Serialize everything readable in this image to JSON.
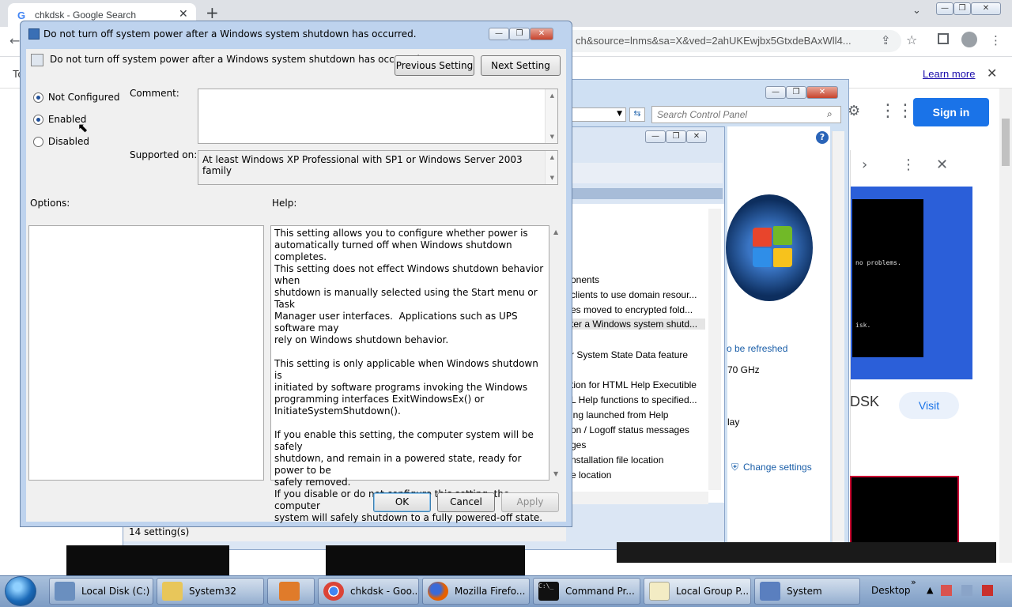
{
  "chrome": {
    "tab_title": "chkdsk - Google Search",
    "tab_favicon": "G",
    "new_tab": "+",
    "url_fragment": "ch&source=lnms&sa=X&ved=2ahUKEwjbx5GtxdeBAxWll4...",
    "infobar_left": "To",
    "learn_more": "Learn more",
    "sign_in": "Sign in",
    "card_title_fragment": "DSK",
    "visit": "Visit",
    "card_terminal_lines": [
      "no problems.",
      "",
      "",
      "",
      "isk."
    ]
  },
  "control_panel": {
    "search_placeholder": "Search Control Panel",
    "to_be_refreshed": "o be refreshed",
    "cpu_speed": "70 GHz",
    "display_fragment": "lay",
    "change_settings": "Change settings"
  },
  "group_policy": {
    "items": [
      "onents",
      "clients to use domain resour...",
      "es moved to encrypted fold...",
      "ter a Windows system shutd...",
      "r System State Data feature",
      "tion for HTML Help Executible",
      "L Help functions to specified...",
      "ing launched from Help",
      "on / Logoff status messages",
      "ges",
      "nstallation file location",
      "e location"
    ],
    "status_count": "14 setting(s)"
  },
  "dialog": {
    "title": "Do not turn off system power after a Windows system shutdown has occurred.",
    "heading": "Do not turn off system power after a Windows system shutdown has occurred.",
    "previous_setting": "Previous Setting",
    "next_setting": "Next Setting",
    "radios": {
      "not_configured": "Not Configured",
      "enabled": "Enabled",
      "disabled": "Disabled",
      "selected": "not_configured"
    },
    "comment_label": "Comment:",
    "supported_label": "Supported on:",
    "supported_value": "At least Windows XP Professional with SP1 or Windows Server 2003 family",
    "options_label": "Options:",
    "help_label": "Help:",
    "help_text": "This setting allows you to configure whether power is\nautomatically turned off when Windows shutdown completes.\nThis setting does not effect Windows shutdown behavior when\nshutdown is manually selected using the Start menu or Task\nManager user interfaces.  Applications such as UPS software may\nrely on Windows shutdown behavior.\n\nThis setting is only applicable when Windows shutdown is\ninitiated by software programs invoking the Windows\nprogramming interfaces ExitWindowsEx() or\nInitiateSystemShutdown().\n\nIf you enable this setting, the computer system will be safely\nshutdown, and remain in a powered state, ready for power to be\nsafely removed.\nIf you disable or do not configure this setting, the computer\nsystem will safely shutdown to a fully powered-off state.",
    "ok": "OK",
    "cancel": "Cancel",
    "apply": "Apply"
  },
  "taskbar": {
    "items": [
      {
        "label": "Local Disk (C:)",
        "icon": "drive-icon",
        "color": "#6a8fbf"
      },
      {
        "label": "System32",
        "icon": "folder-icon",
        "color": "#e8c65a"
      },
      {
        "label": "",
        "icon": "media-player-icon",
        "color": "#e07b2a"
      },
      {
        "label": "chkdsk - Goo...",
        "icon": "chrome-icon",
        "color": "#db4437"
      },
      {
        "label": "Mozilla Firefo...",
        "icon": "firefox-icon",
        "color": "#e66000"
      },
      {
        "label": "Command Pr...",
        "icon": "cmd-icon",
        "color": "#111111"
      },
      {
        "label": "Local Group P...",
        "icon": "group-policy-icon",
        "color": "#f3ecc4"
      },
      {
        "label": "System",
        "icon": "system-icon",
        "color": "#5a7fbf"
      }
    ],
    "desktop": "Desktop"
  }
}
